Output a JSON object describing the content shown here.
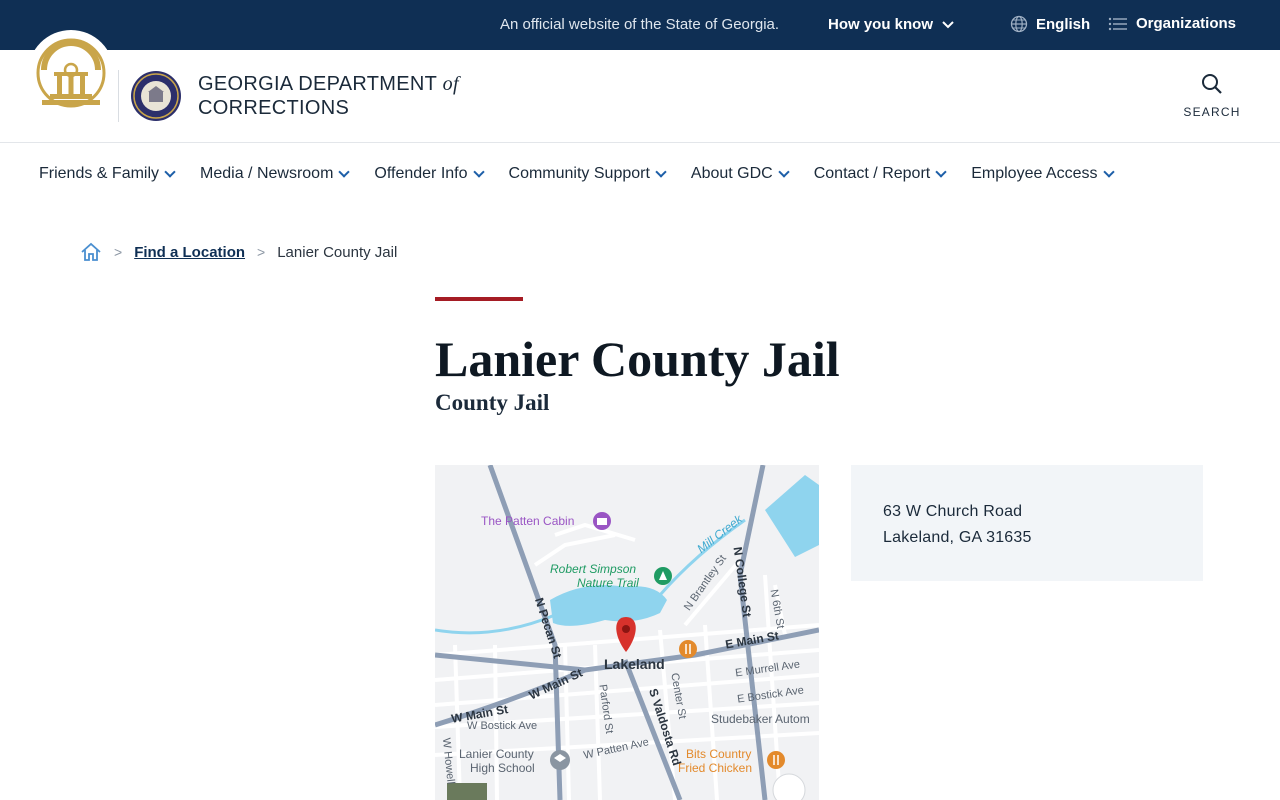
{
  "banner": {
    "official_text": "An official website of the State of Georgia.",
    "how_you_know": "How you know",
    "language": "English",
    "organizations": "Organizations"
  },
  "header": {
    "agency_line1": "GEORGIA DEPARTMENT",
    "agency_of": "of",
    "agency_line2": "CORRECTIONS",
    "search_label": "SEARCH"
  },
  "nav": {
    "items": [
      {
        "label": "Friends & Family"
      },
      {
        "label": "Media / Newsroom"
      },
      {
        "label": "Offender Info"
      },
      {
        "label": "Community Support"
      },
      {
        "label": "About GDC"
      },
      {
        "label": "Contact / Report"
      },
      {
        "label": "Employee Access"
      }
    ]
  },
  "breadcrumb": {
    "home_icon": "home-icon",
    "link": "Find a Location",
    "current": "Lanier County Jail"
  },
  "page": {
    "title": "Lanier County Jail",
    "subtitle": "County Jail"
  },
  "address": {
    "line1": "63 W Church Road",
    "line2": "Lakeland, GA 31635"
  },
  "map": {
    "labels": {
      "patten_cabin": "The Patten Cabin",
      "mill_creek": "Mill Creek",
      "robert_simpson": "Robert Simpson",
      "nature_trail": "Nature Trail",
      "n_brantley": "N Brantley St",
      "n_college": "N College St",
      "n_6th": "N 6th St",
      "n_pecan": "N Pecan St",
      "e_main": "E Main St",
      "lakeland": "Lakeland",
      "e_murrell": "E Murrell Ave",
      "e_bostick": "E Bostick Ave",
      "w_main_1": "W Main St",
      "w_main_2": "W Main St",
      "w_bostick": "W Bostick Ave",
      "parford": "Parford St",
      "s_valdosta": "S Valdosta Rd",
      "center": "Center St",
      "studebaker": "Studebaker Autom",
      "lanier_hs_1": "Lanier County",
      "lanier_hs_2": "High School",
      "w_patten": "W Patten Ave",
      "bits_1": "Bits Country",
      "bits_2": "Fried Chicken",
      "w_howell": "W Howell"
    },
    "colors": {
      "water": "#8fd4ee",
      "road_major": "#8e9eb5",
      "road_minor": "#ffffff",
      "poi_purple": "#9a55c4",
      "poi_green": "#1f9b63",
      "poi_orange": "#e38a2c",
      "pin_red": "#d7322c"
    }
  },
  "colors": {
    "banner_bg": "#0f2f54",
    "accent_red": "#a51c24",
    "seal_gold": "#c9a54a",
    "link_blue": "#1d5fa8"
  }
}
